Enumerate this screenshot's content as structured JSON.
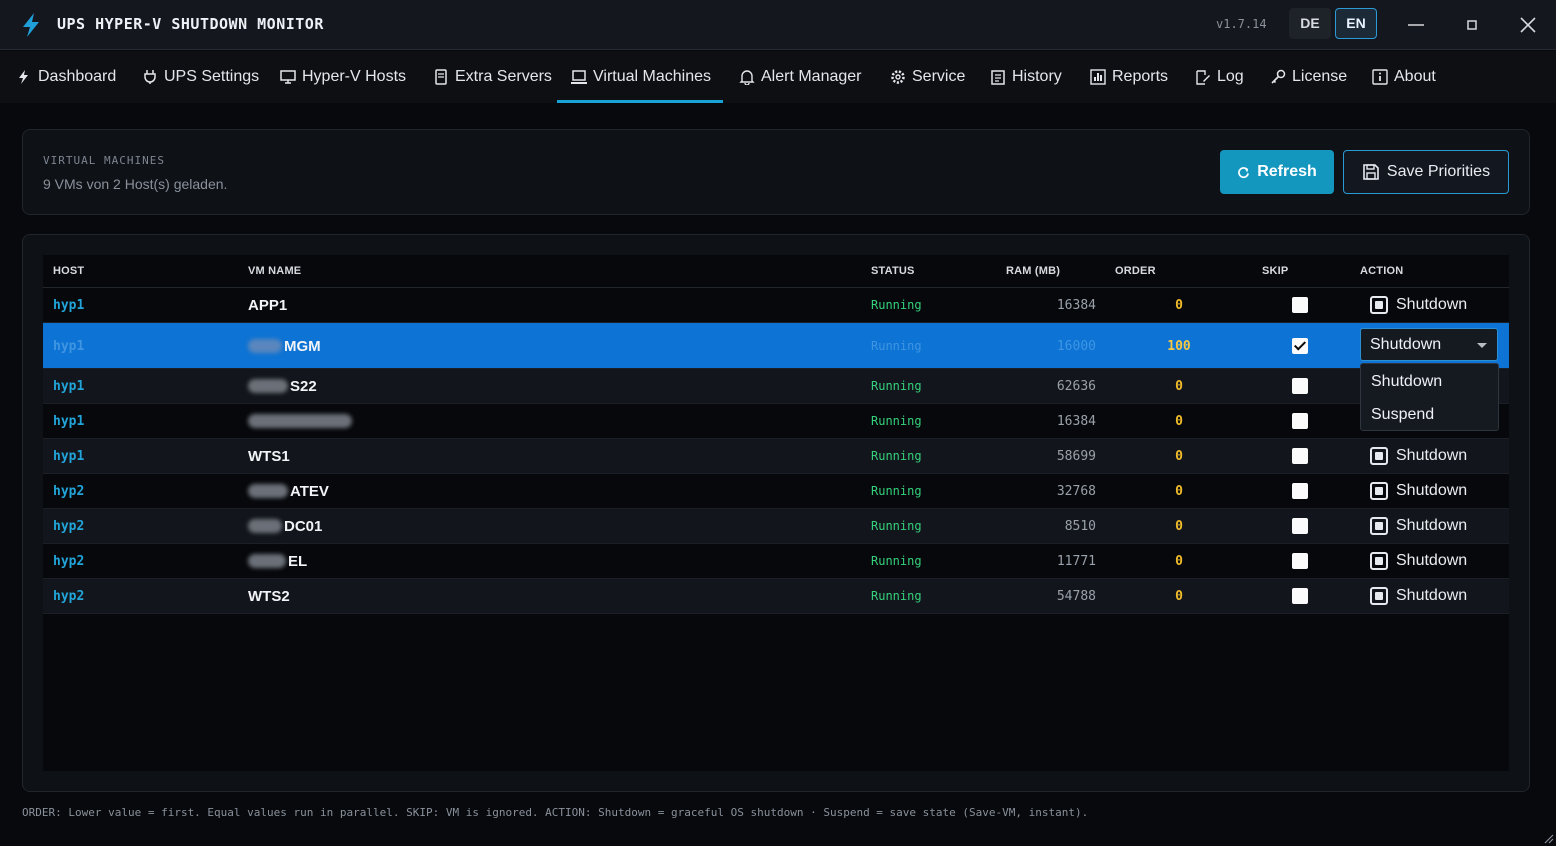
{
  "window": {
    "title": "UPS HYPER-V SHUTDOWN MONITOR",
    "version": "v1.7.14",
    "lang_de": "DE",
    "lang_en": "EN",
    "active_lang": "EN"
  },
  "nav": {
    "tabs": [
      {
        "label": "Dashboard",
        "icon": "bolt-icon"
      },
      {
        "label": "UPS Settings",
        "icon": "plug-icon"
      },
      {
        "label": "Hyper-V Hosts",
        "icon": "monitor-icon"
      },
      {
        "label": "Extra Servers",
        "icon": "server-icon"
      },
      {
        "label": "Virtual Machines",
        "icon": "laptop-icon",
        "active": true
      },
      {
        "label": "Alert Manager",
        "icon": "bell-icon"
      },
      {
        "label": "Service",
        "icon": "gear-icon"
      },
      {
        "label": "History",
        "icon": "clipboard-icon"
      },
      {
        "label": "Reports",
        "icon": "bar-chart-icon"
      },
      {
        "label": "Log",
        "icon": "edit-icon"
      },
      {
        "label": "License",
        "icon": "key-icon"
      },
      {
        "label": "About",
        "icon": "info-icon"
      }
    ]
  },
  "header": {
    "section_label": "VIRTUAL MACHINES",
    "subtitle": "9 VMs von 2 Host(s) geladen.",
    "refresh_label": "Refresh",
    "save_label": "Save Priorities"
  },
  "table": {
    "columns": [
      "HOST",
      "VM NAME",
      "STATUS",
      "RAM (MB)",
      "ORDER",
      "SKIP",
      "ACTION"
    ],
    "rows": [
      {
        "host": "hyp1",
        "vm": "APP1",
        "status": "Running",
        "ram": "16384",
        "order": "0",
        "skip": false,
        "action": "Shutdown"
      },
      {
        "host": "hyp1",
        "vm": "MGM",
        "status": "Running",
        "ram": "16000",
        "order": "100",
        "skip": true,
        "action": "Shutdown",
        "selected": true
      },
      {
        "host": "hyp1",
        "vm": "S22",
        "status": "Running",
        "ram": "62636",
        "order": "0",
        "skip": false,
        "action": "Shutdown"
      },
      {
        "host": "hyp1",
        "vm": "",
        "status": "Running",
        "ram": "16384",
        "order": "0",
        "skip": false,
        "action": "Shutdown"
      },
      {
        "host": "hyp1",
        "vm": "WTS1",
        "status": "Running",
        "ram": "58699",
        "order": "0",
        "skip": false,
        "action": "Shutdown"
      },
      {
        "host": "hyp2",
        "vm": "ATEV",
        "status": "Running",
        "ram": "32768",
        "order": "0",
        "skip": false,
        "action": "Shutdown"
      },
      {
        "host": "hyp2",
        "vm": "DC01",
        "status": "Running",
        "ram": "8510",
        "order": "0",
        "skip": false,
        "action": "Shutdown"
      },
      {
        "host": "hyp2",
        "vm": "EL",
        "status": "Running",
        "ram": "11771",
        "order": "0",
        "skip": false,
        "action": "Shutdown"
      },
      {
        "host": "hyp2",
        "vm": "WTS2",
        "status": "Running",
        "ram": "54788",
        "order": "0",
        "skip": false,
        "action": "Shutdown"
      }
    ]
  },
  "dropdown": {
    "selected": "Shutdown",
    "options": [
      "Shutdown",
      "Suspend"
    ]
  },
  "footer": "ORDER: Lower value = first. Equal values run in parallel. SKIP: VM is ignored. ACTION: Shutdown = graceful OS shutdown · Suspend = save state (Save-VM, instant).",
  "colors": {
    "accent": "#19a3d4",
    "selected_row": "#0d73d4",
    "status_running": "#35d07c",
    "order": "#f0bc2c"
  }
}
